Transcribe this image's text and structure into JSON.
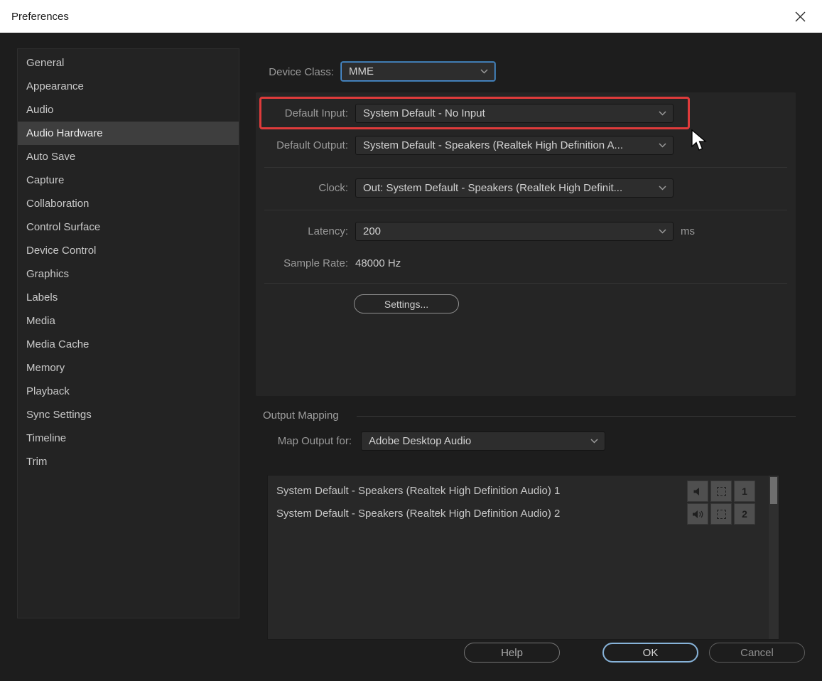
{
  "colors": {
    "background": "#1d1d1d",
    "panel": "#252525",
    "accent_blue": "#4b8fd6",
    "annotation_red": "#df3b3b",
    "selected_item": "#3e3e3e"
  },
  "window": {
    "title": "Preferences"
  },
  "sidebar": {
    "items": [
      {
        "label": "General",
        "selected": false
      },
      {
        "label": "Appearance",
        "selected": false
      },
      {
        "label": "Audio",
        "selected": false
      },
      {
        "label": "Audio Hardware",
        "selected": true
      },
      {
        "label": "Auto Save",
        "selected": false
      },
      {
        "label": "Capture",
        "selected": false
      },
      {
        "label": "Collaboration",
        "selected": false
      },
      {
        "label": "Control Surface",
        "selected": false
      },
      {
        "label": "Device Control",
        "selected": false
      },
      {
        "label": "Graphics",
        "selected": false
      },
      {
        "label": "Labels",
        "selected": false
      },
      {
        "label": "Media",
        "selected": false
      },
      {
        "label": "Media Cache",
        "selected": false
      },
      {
        "label": "Memory",
        "selected": false
      },
      {
        "label": "Playback",
        "selected": false
      },
      {
        "label": "Sync Settings",
        "selected": false
      },
      {
        "label": "Timeline",
        "selected": false
      },
      {
        "label": "Trim",
        "selected": false
      }
    ]
  },
  "main": {
    "device_class": {
      "label": "Device Class:",
      "value": "MME"
    },
    "hardware": {
      "default_input": {
        "label": "Default Input:",
        "value": "System Default - No Input"
      },
      "default_output": {
        "label": "Default Output:",
        "value": "System Default - Speakers (Realtek High Definition A..."
      },
      "clock": {
        "label": "Clock:",
        "value": "Out: System Default - Speakers (Realtek High Definit..."
      },
      "latency": {
        "label": "Latency:",
        "value": "200",
        "unit": "ms"
      },
      "sample_rate": {
        "label": "Sample Rate:",
        "value": "48000 Hz"
      },
      "settings_button": "Settings..."
    },
    "output_mapping": {
      "title": "Output Mapping",
      "map_output_for": {
        "label": "Map Output for:",
        "value": "Adobe Desktop Audio"
      },
      "rows": [
        {
          "label": "System Default - Speakers (Realtek High Definition Audio) 1",
          "channel": "1"
        },
        {
          "label": "System Default - Speakers (Realtek High Definition Audio) 2",
          "channel": "2"
        }
      ]
    }
  },
  "footer": {
    "help": "Help",
    "ok": "OK",
    "cancel": "Cancel"
  }
}
